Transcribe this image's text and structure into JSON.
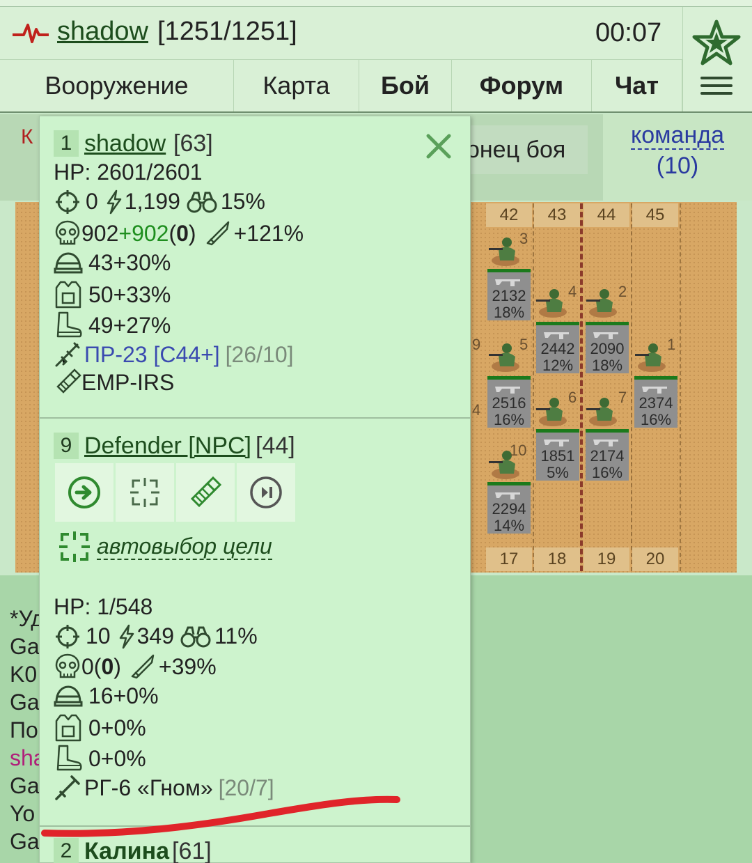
{
  "header": {
    "username": "shadow",
    "hp": "[1251/1251]",
    "time": "00:07",
    "logo_icon": "pulse-icon",
    "rank_icon": "star-icon",
    "menu_icon": "hamburger-icon"
  },
  "nav": {
    "tabs": [
      {
        "label": "Вооружение"
      },
      {
        "label": "Карта"
      },
      {
        "label": "Бой"
      },
      {
        "label": "Форум"
      },
      {
        "label": "Чат"
      }
    ]
  },
  "battle": {
    "end_button": "онец боя",
    "team_link_line1": "команда",
    "team_link_line2": "(10)",
    "left_fragment": "К",
    "columns_top": [
      "42",
      "43",
      "44",
      "45"
    ],
    "columns_bottom": [
      "17",
      "18",
      "19",
      "20"
    ],
    "unit_numbers": [
      "3",
      "4",
      "2",
      "5",
      "9",
      "1",
      "6",
      "7",
      "4",
      "10"
    ],
    "cells": [
      {
        "value": "2132",
        "pct": "18%"
      },
      {
        "value": "2442",
        "pct": "12%"
      },
      {
        "value": "2090",
        "pct": "18%"
      },
      {
        "value": "2516",
        "pct": "16%"
      },
      {
        "value": "2374",
        "pct": "16%"
      },
      {
        "value": "1851",
        "pct": "5%"
      },
      {
        "value": "2174",
        "pct": "16%"
      },
      {
        "value": "2294",
        "pct": "14%"
      }
    ]
  },
  "chat_fragments": [
    "*Уд",
    "Ga",
    "K0",
    "Ga",
    "По",
    "sha",
    "Ga",
    "Yo",
    "Ga"
  ],
  "popup": {
    "player": {
      "num": "1",
      "name": "shadow",
      "level": "[63]",
      "hp": "HP: 2601/2601",
      "accuracy": "0",
      "energy": "1,199",
      "vision": "15%",
      "kills_base": "902",
      "kills_plus": "+902",
      "kills_paren_open": "(",
      "kills_paren_val": "0",
      "kills_paren_close": ")",
      "damage": "+121%",
      "helmet": "43+30%",
      "armor": "50+33%",
      "boots": "49+27%",
      "weapon_name": "ПР-23 [С44+]",
      "weapon_ammo": "[26/10]",
      "grenade": "EMP-IRS"
    },
    "target": {
      "num": "9",
      "name": "Defender [NPC]",
      "level": "[44]",
      "auto_target": "автовыбор цели",
      "hp": "HP: 1/548",
      "accuracy": "10",
      "energy": "349",
      "vision": "11%",
      "kills_base": "0",
      "kills_paren_open": "(",
      "kills_paren_val": "0",
      "kills_paren_close": ")",
      "damage": "+39%",
      "helmet": "16+0%",
      "armor": "0+0%",
      "boots": "0+0%",
      "weapon_name": "РГ-6 «Гном»",
      "weapon_ammo": "[20/7]"
    },
    "next": {
      "num": "2",
      "name": "Калина",
      "level": "[61]"
    },
    "colors": {
      "green_accent": "#1e8e1e",
      "weapon_blue": "#3a4ab0",
      "marker_red": "#e0242a"
    }
  }
}
